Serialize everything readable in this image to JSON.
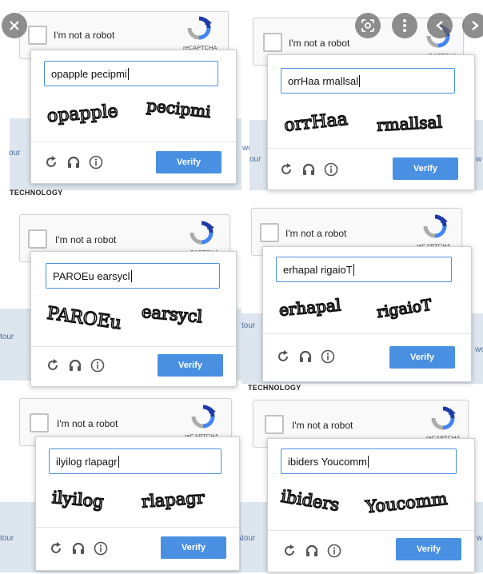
{
  "tiles": [
    {
      "checkbox_label": "I'm not a robot",
      "recaptcha_label": "reCAPTCHA",
      "input_value": "opapple pecipmi",
      "captcha_words": [
        "opapple",
        "pecipmi"
      ],
      "verify_label": "Verify",
      "side_left": "our",
      "side_right": "wo",
      "footer": "TECHNOLOGY"
    },
    {
      "checkbox_label": "I'm not a robot",
      "recaptcha_label": "reCAPTCHA",
      "input_value": "orrHaa rmallsal",
      "captcha_words": [
        "orrHaa",
        "rmallsal"
      ],
      "verify_label": "Verify",
      "side_left": "our",
      "side_right": "w",
      "footer": ""
    },
    {
      "checkbox_label": "I'm not a robot",
      "recaptcha_label": "reCAPTCHA",
      "input_value": "PAROEu earsycl",
      "captcha_words": [
        "PAROEu",
        "earsycl"
      ],
      "verify_label": "Verify",
      "side_left": "tour",
      "side_right": "",
      "footer": ""
    },
    {
      "checkbox_label": "I'm not a robot",
      "recaptcha_label": "reCAPTCHA",
      "input_value": "erhapal rigaioT",
      "captcha_words": [
        "erhapal",
        "rigaioT"
      ],
      "verify_label": "Verify",
      "side_left": "tour",
      "side_right": "wo",
      "footer": "TECHNOLOGY"
    },
    {
      "checkbox_label": "I'm not a robot",
      "recaptcha_label": "reCAPTCHA",
      "input_value": "ilyilog rlapagr",
      "captcha_words": [
        "ilyilog",
        "rlapagr"
      ],
      "verify_label": "Verify",
      "side_left": "tour",
      "side_right": "w",
      "footer": ""
    },
    {
      "checkbox_label": "I'm not a robot",
      "recaptcha_label": "reCAPTCHA",
      "input_value": "ibiders Youcomm",
      "captcha_words": [
        "ibiders",
        "Youcomm"
      ],
      "verify_label": "Verify",
      "side_left": "tour",
      "side_right": "w",
      "footer": ""
    }
  ],
  "icons": {
    "reload": "reload-icon",
    "audio": "headphones-icon",
    "info": "info-icon"
  },
  "viewer_controls": [
    "close",
    "lens",
    "more",
    "previous",
    "next"
  ]
}
